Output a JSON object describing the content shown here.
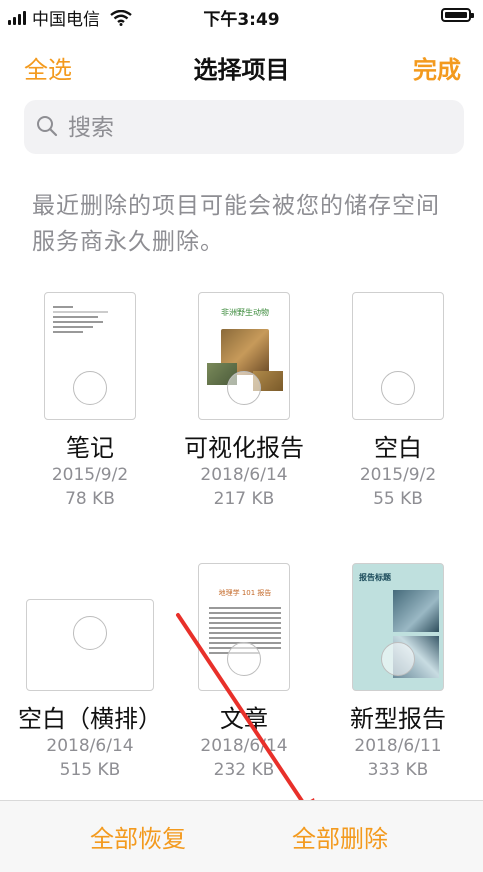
{
  "status": {
    "carrier": "中国电信",
    "time": "下午3:49"
  },
  "nav": {
    "select_all": "全选",
    "title": "选择项目",
    "done": "完成"
  },
  "search": {
    "placeholder": "搜索"
  },
  "notice": "最近删除的项目可能会被您的储存空间服务商永久删除。",
  "items": [
    {
      "name": "笔记",
      "date": "2015/9/2",
      "size": "78 KB"
    },
    {
      "name": "可视化报告",
      "date": "2018/6/14",
      "size": "217 KB",
      "thumb_title": "非洲野生动物"
    },
    {
      "name": "空白",
      "date": "2015/9/2",
      "size": "55 KB"
    },
    {
      "name": "空白（横排）",
      "date": "2018/6/14",
      "size": "515 KB"
    },
    {
      "name": "文章",
      "date": "2018/6/14",
      "size": "232 KB",
      "thumb_title": "地理学 101 报告"
    },
    {
      "name": "新型报告",
      "date": "2018/6/11",
      "size": "333 KB",
      "thumb_title": "报告标题"
    }
  ],
  "toolbar": {
    "recover_all": "全部恢复",
    "delete_all": "全部删除"
  },
  "colors": {
    "accent": "#f39a1e",
    "secondary_text": "#8e8e93"
  }
}
